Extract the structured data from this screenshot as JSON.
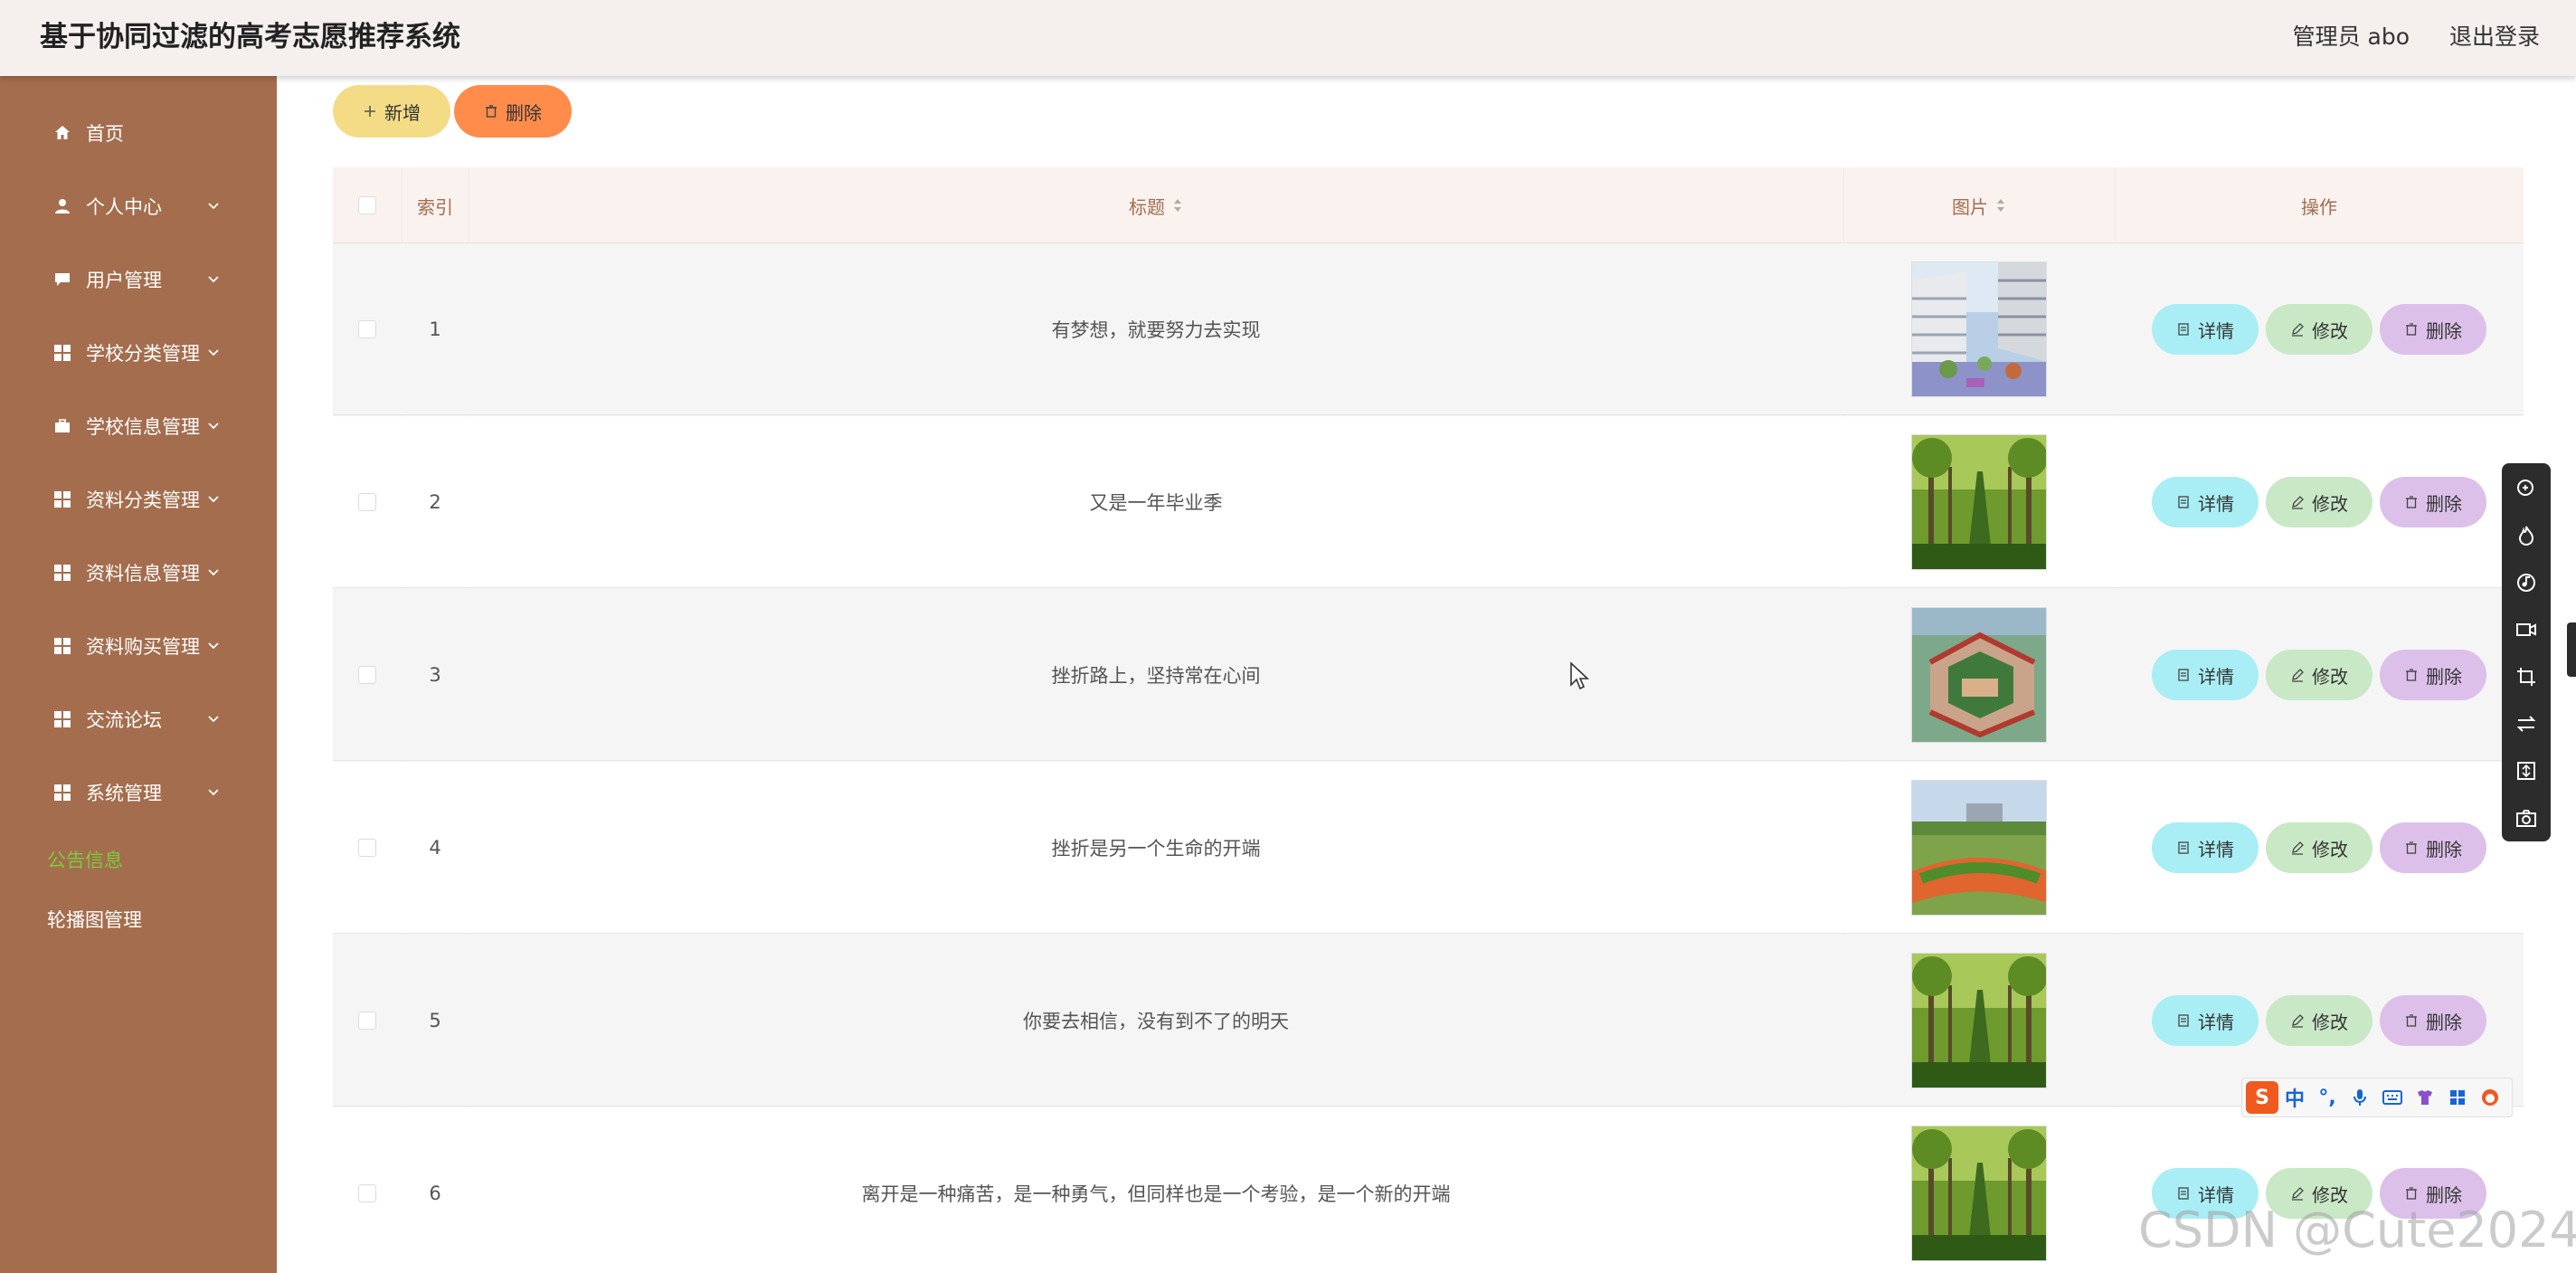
{
  "header": {
    "title": "基于协同过滤的高考志愿推荐系统",
    "user_label": "管理员 abo",
    "logout_label": "退出登录"
  },
  "sidebar": {
    "items": [
      {
        "label": "首页",
        "icon": "home-icon"
      },
      {
        "label": "个人中心",
        "icon": "user-icon"
      },
      {
        "label": "用户管理",
        "icon": "chat-icon"
      },
      {
        "label": "学校分类管理",
        "icon": "grid-icon"
      },
      {
        "label": "学校信息管理",
        "icon": "briefcase-icon"
      },
      {
        "label": "资料分类管理",
        "icon": "grid-icon"
      },
      {
        "label": "资料信息管理",
        "icon": "grid-icon"
      },
      {
        "label": "资料购买管理",
        "icon": "grid-icon"
      },
      {
        "label": "交流论坛",
        "icon": "grid-icon"
      },
      {
        "label": "系统管理",
        "icon": "grid-icon"
      }
    ],
    "subitems": [
      {
        "label": "公告信息",
        "active": true
      },
      {
        "label": "轮播图管理",
        "active": false
      }
    ]
  },
  "toolbar": {
    "add_label": "新增",
    "delete_label": "删除"
  },
  "table": {
    "headers": {
      "index": "索引",
      "title": "标题",
      "image": "图片",
      "actions": "操作"
    },
    "rows": [
      {
        "index": "1",
        "title": "有梦想，就要努力去实现",
        "image": "campus-building-photo"
      },
      {
        "index": "2",
        "title": "又是一年毕业季",
        "image": "tree-lined-road-photo"
      },
      {
        "index": "3",
        "title": "挫折路上，坚持常在心间",
        "image": "campus-aerial-photo"
      },
      {
        "index": "4",
        "title": "挫折是另一个生命的开端",
        "image": "sports-field-photo"
      },
      {
        "index": "5",
        "title": "你要去相信，没有到不了的明天",
        "image": "tree-lined-road-photo"
      },
      {
        "index": "6",
        "title": "离开是一种痛苦，是一种勇气，但同样也是一个考验，是一个新的开端",
        "image": "tree-lined-road-photo"
      }
    ],
    "action_labels": {
      "detail": "详情",
      "edit": "修改",
      "remove": "删除"
    }
  },
  "ime": {
    "logo": "S",
    "mode": "中",
    "punct": "°,"
  },
  "watermark": "CSDN @Cute2024_",
  "colors": {
    "sidebar_bg": "#a46d4d",
    "header_bg": "#f5f0ee",
    "add_btn": "#f3dc85",
    "delete_btn": "#ff8c4b",
    "detail_btn": "#a8eef4",
    "edit_btn": "#c9e8c6",
    "remove_btn": "#dcc0ea",
    "active_menu": "#7acb3c"
  }
}
